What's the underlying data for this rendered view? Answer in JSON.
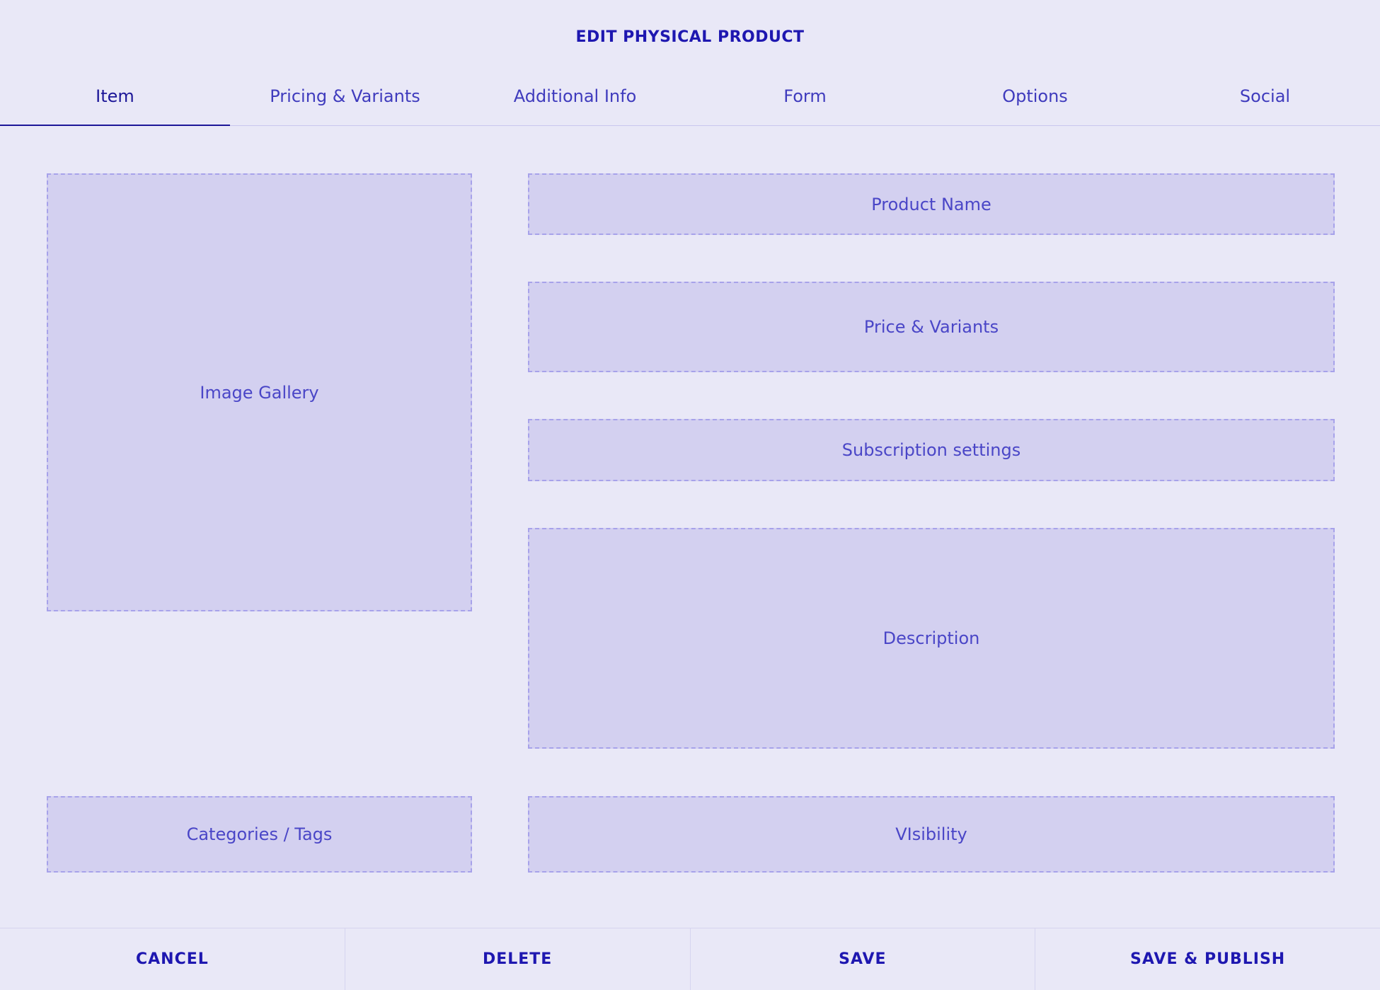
{
  "header": {
    "title": "EDIT PHYSICAL PRODUCT"
  },
  "tabs": [
    {
      "label": "Item",
      "active": true
    },
    {
      "label": "Pricing & Variants",
      "active": false
    },
    {
      "label": "Additional Info",
      "active": false
    },
    {
      "label": "Form",
      "active": false
    },
    {
      "label": "Options",
      "active": false
    },
    {
      "label": "Social",
      "active": false
    }
  ],
  "left_column": {
    "image_gallery": "Image Gallery",
    "categories_tags": "Categories / Tags"
  },
  "right_column": {
    "product_name": "Product Name",
    "price_variants": "Price & Variants",
    "subscription_settings": "Subscription settings",
    "description": "Description",
    "visibility": "VIsibility"
  },
  "footer": {
    "cancel": "CANCEL",
    "delete": "DELETE",
    "save": "SAVE",
    "save_publish": "SAVE & PUBLISH"
  },
  "colors": {
    "background": "#e9e8f7",
    "slot_fill": "#d3d0f0",
    "slot_border": "#a7a2ea",
    "accent": "#1e17b0",
    "text": "#4a46c7"
  }
}
